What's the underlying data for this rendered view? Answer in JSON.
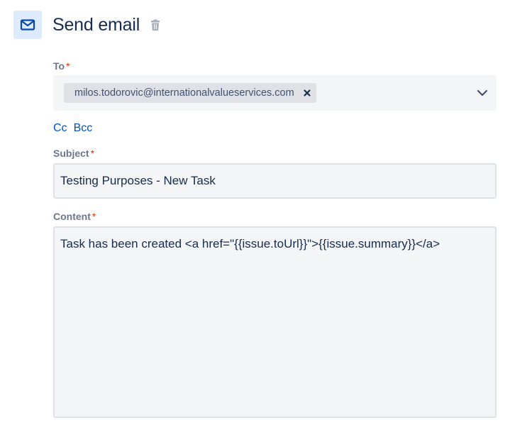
{
  "header": {
    "title": "Send email",
    "icon": "mail-icon",
    "delete_icon": "trash-icon"
  },
  "to": {
    "label": "To",
    "required_mark": "*",
    "recipients": [
      {
        "email": "milos.todorovic@internationalvalueservices.com"
      }
    ],
    "remove_icon": "close-icon",
    "dropdown_icon": "chevron-down-icon"
  },
  "cc_label": "Cc",
  "bcc_label": "Bcc",
  "subject": {
    "label": "Subject",
    "required_mark": "*",
    "value": "Testing Purposes - New Task"
  },
  "content": {
    "label": "Content",
    "required_mark": "*",
    "value": "Task has been created <a href=\"{{issue.toUrl}}\">{{issue.summary}}</a>"
  },
  "colors": {
    "accent": "#0052cc",
    "icon_bg": "#deebff",
    "required": "#de350b",
    "field_bg": "#f4f5f7",
    "chip_bg": "#dfe1e6"
  }
}
